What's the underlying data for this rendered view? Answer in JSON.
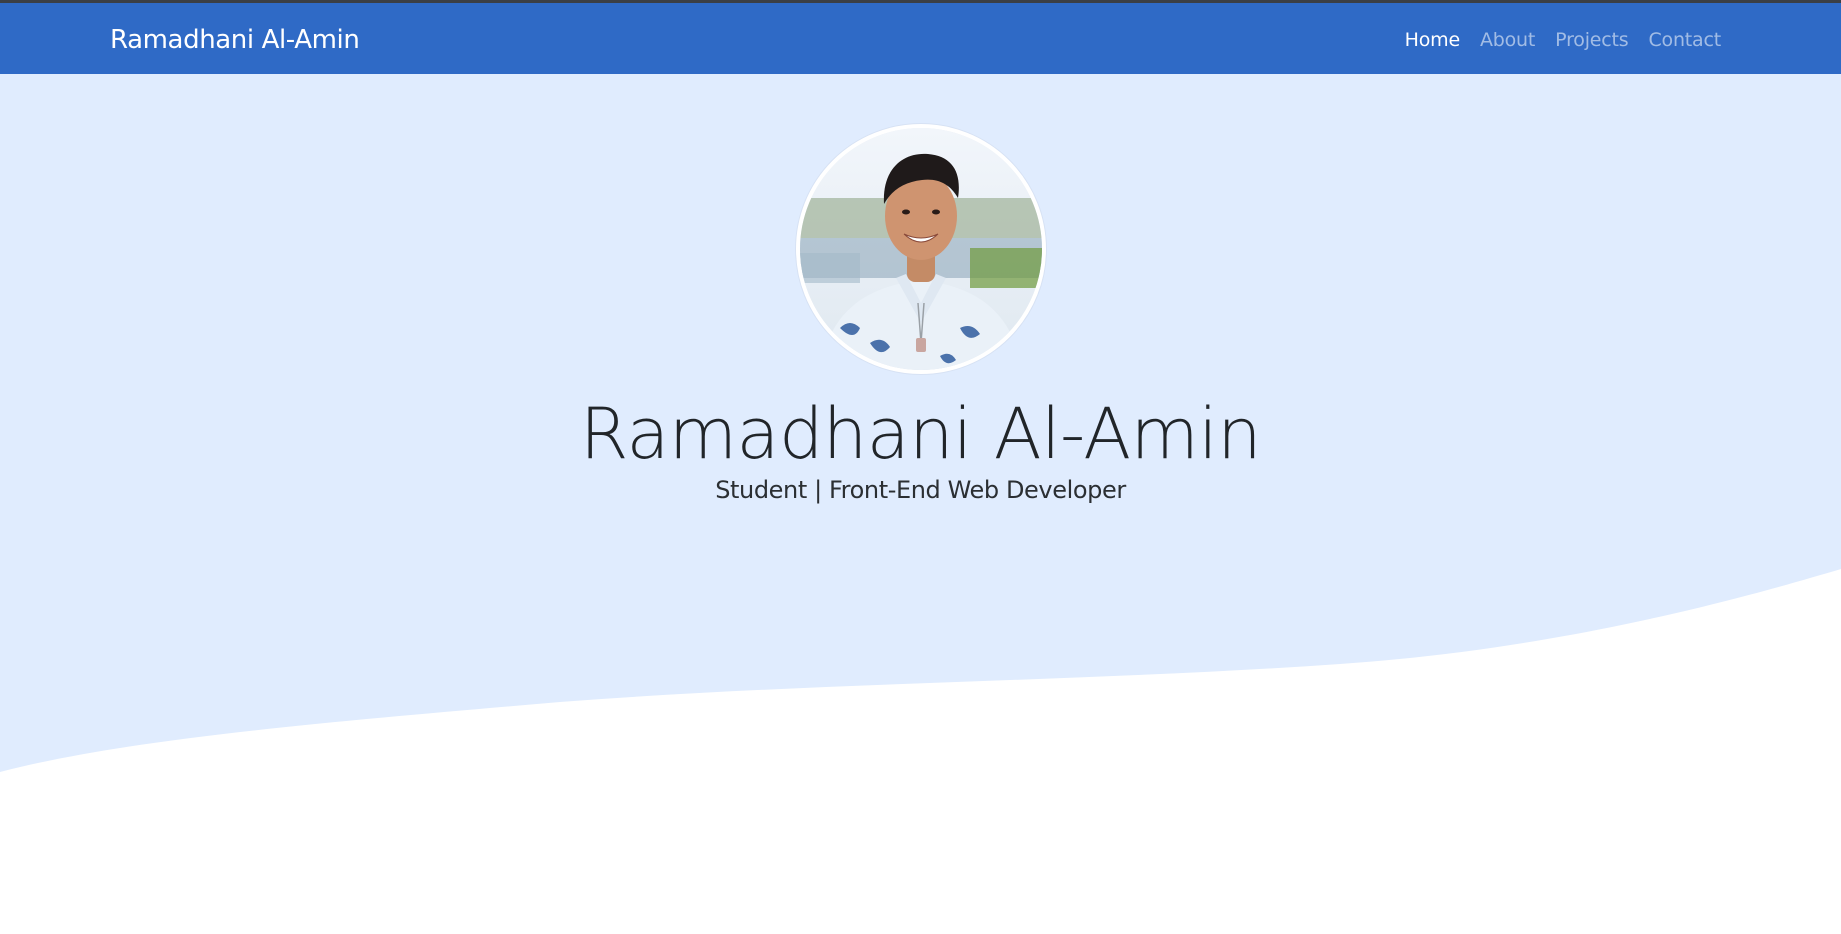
{
  "navbar": {
    "brand": "Ramadhani Al-Amin",
    "links": [
      {
        "label": "Home",
        "active": true
      },
      {
        "label": "About",
        "active": false
      },
      {
        "label": "Projects",
        "active": false
      },
      {
        "label": "Contact",
        "active": false
      }
    ]
  },
  "hero": {
    "title": "Ramadhani Al-Amin",
    "subtitle": "Student | Front-End Web Developer"
  },
  "colors": {
    "navbar_bg": "#2f6ac6",
    "hero_bg": "#e0ecfe",
    "text_dark": "#212529"
  }
}
